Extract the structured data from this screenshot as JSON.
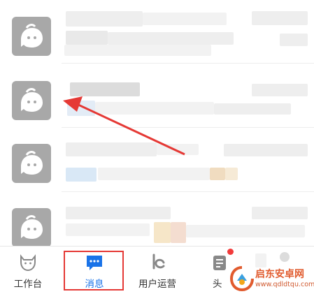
{
  "tabs": [
    {
      "label": "工作台",
      "icon": "cow-icon"
    },
    {
      "label": "消息",
      "icon": "chat-bubble-icon",
      "active": true
    },
    {
      "label": "用户运营",
      "icon": "user-ops-icon"
    },
    {
      "label": "头",
      "icon": "document-icon",
      "badge": true
    }
  ],
  "colors": {
    "active": "#1a73e8",
    "annotation": "#e53935",
    "badge": "#f23b3b"
  },
  "watermark": {
    "title": "启东安卓网",
    "url": "www.qdldtqu.com"
  }
}
